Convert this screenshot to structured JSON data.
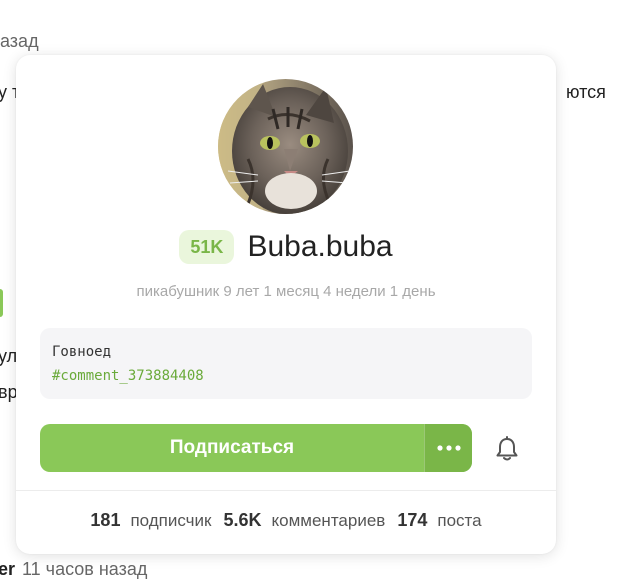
{
  "background": {
    "line1": "азад",
    "line2_left": "у т",
    "line2_right": "ются",
    "line3": "ул",
    "line4": "вр",
    "author_fragment": "er",
    "time_ago": "11 часов назад"
  },
  "card": {
    "rating": "51K",
    "username": "Buba.buba",
    "member_since": "пикабушник 9 лет 1 месяц 4 недели 1 день",
    "note": {
      "text": "Говноед",
      "link": "#comment_373884408"
    },
    "subscribe_label": "Подписаться",
    "more_icon": "ellipsis-icon",
    "bell_icon": "bell-icon",
    "stats": [
      {
        "value": "181",
        "label": "подписчик"
      },
      {
        "value": "5.6K",
        "label": "комментариев"
      },
      {
        "value": "174",
        "label": "поста"
      }
    ]
  },
  "colors": {
    "accent": "#8ac858",
    "accent_dark": "#7ab648",
    "rating_bg": "#eaf6dc"
  }
}
